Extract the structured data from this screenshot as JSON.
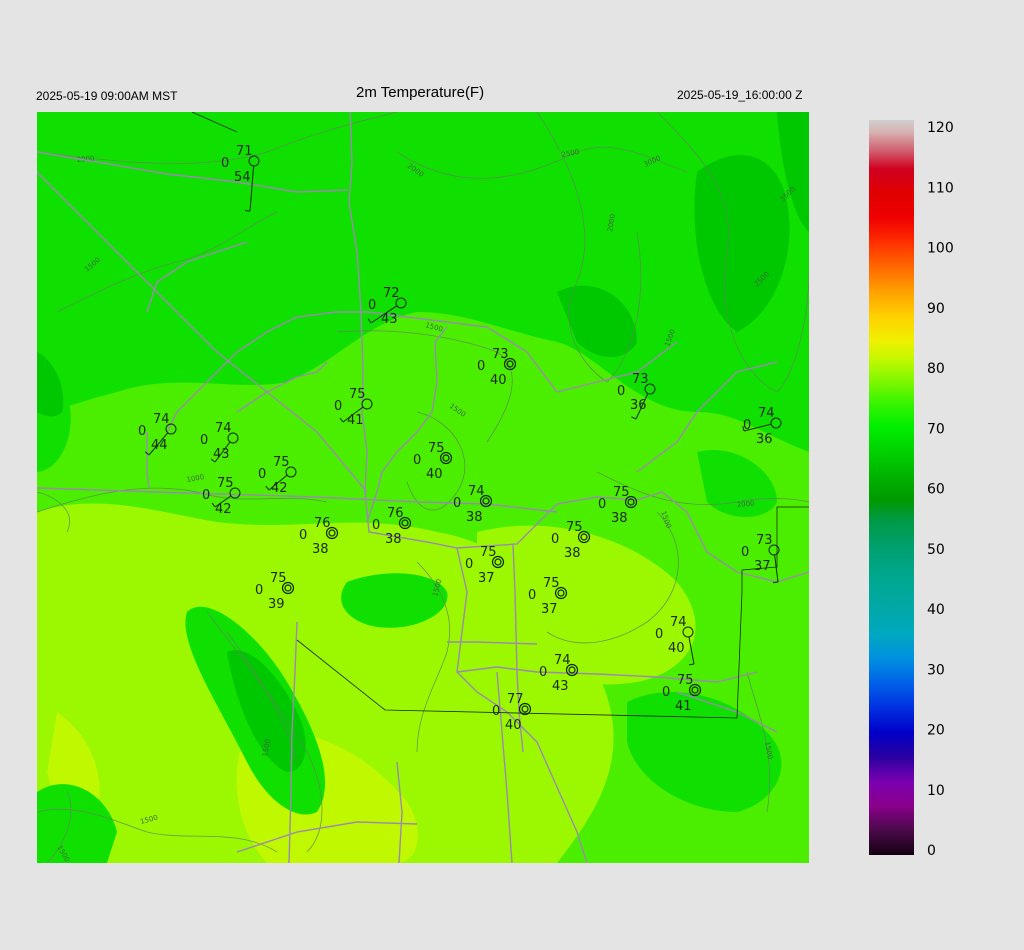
{
  "header": {
    "valid_local": "2025-05-19 09:00AM MST",
    "title": "2m Temperature(F)",
    "valid_utc": "2025-05-19_16:00:00 Z"
  },
  "colorbar": {
    "ticks": [
      "120",
      "110",
      "100",
      "90",
      "80",
      "70",
      "60",
      "50",
      "40",
      "30",
      "20",
      "10",
      "0"
    ],
    "stops": [
      {
        "v": 0,
        "c": "#150010"
      },
      {
        "v": 4,
        "c": "#4a0a4a"
      },
      {
        "v": 8,
        "c": "#8a008a"
      },
      {
        "v": 12,
        "c": "#7a00b0"
      },
      {
        "v": 16,
        "c": "#2a00a0"
      },
      {
        "v": 20,
        "c": "#0000c8"
      },
      {
        "v": 24,
        "c": "#0030e0"
      },
      {
        "v": 28,
        "c": "#0060e8"
      },
      {
        "v": 32,
        "c": "#0090e0"
      },
      {
        "v": 36,
        "c": "#00a8c0"
      },
      {
        "v": 40,
        "c": "#00a8a8"
      },
      {
        "v": 45,
        "c": "#00a890"
      },
      {
        "v": 50,
        "c": "#00a070"
      },
      {
        "v": 55,
        "c": "#009a40"
      },
      {
        "v": 58,
        "c": "#009a00"
      },
      {
        "v": 62,
        "c": "#00b400"
      },
      {
        "v": 66,
        "c": "#00d200"
      },
      {
        "v": 70,
        "c": "#00f000"
      },
      {
        "v": 74,
        "c": "#3cf400"
      },
      {
        "v": 78,
        "c": "#8cf800"
      },
      {
        "v": 81,
        "c": "#c4f800"
      },
      {
        "v": 84,
        "c": "#f0f000"
      },
      {
        "v": 88,
        "c": "#ffd000"
      },
      {
        "v": 92,
        "c": "#ffa000"
      },
      {
        "v": 96,
        "c": "#ff6800"
      },
      {
        "v": 100,
        "c": "#ff3000"
      },
      {
        "v": 104,
        "c": "#f00000"
      },
      {
        "v": 108,
        "c": "#e00000"
      },
      {
        "v": 112,
        "c": "#d00020"
      },
      {
        "v": 115,
        "c": "#d06070"
      },
      {
        "v": 118,
        "c": "#d8b0b0"
      },
      {
        "v": 120,
        "c": "#d0d0d0"
      }
    ]
  },
  "map": {
    "fill_colors": {
      "base": "#4cee00",
      "warm": "#9cf800",
      "warmer": "#c0f800",
      "cool": "#10e000",
      "cooler": "#00c800"
    },
    "contour_labels": [
      "2000",
      "2000",
      "2500",
      "3000",
      "2000",
      "2500",
      "3500",
      "1500",
      "1500",
      "1500",
      "1500",
      "1000",
      "1500",
      "2000",
      "1500",
      "1500",
      "1500",
      "1500",
      "1500"
    ],
    "stations": [
      {
        "temp": "71",
        "dew": "54",
        "cloud": "0",
        "sky": "clear",
        "wind": "staff"
      },
      {
        "temp": "72",
        "dew": "43",
        "cloud": "0",
        "sky": "clear",
        "wind": "staff"
      },
      {
        "temp": "73",
        "dew": "40",
        "cloud": "0",
        "sky": "calm",
        "wind": "calm"
      },
      {
        "temp": "73",
        "dew": "36",
        "cloud": "0",
        "sky": "clear",
        "wind": "staff"
      },
      {
        "temp": "74",
        "dew": "36",
        "cloud": "0",
        "sky": "clear",
        "wind": "staff"
      },
      {
        "temp": "75",
        "dew": "41",
        "cloud": "0",
        "sky": "clear",
        "wind": "staff"
      },
      {
        "temp": "74",
        "dew": "44",
        "cloud": "0",
        "sky": "clear",
        "wind": "staff"
      },
      {
        "temp": "74",
        "dew": "43",
        "cloud": "0",
        "sky": "clear",
        "wind": "staff"
      },
      {
        "temp": "75",
        "dew": "40",
        "cloud": "0",
        "sky": "calm",
        "wind": "calm"
      },
      {
        "temp": "75",
        "dew": "42",
        "cloud": "0",
        "sky": "clear",
        "wind": "staff"
      },
      {
        "temp": "75",
        "dew": "42",
        "cloud": "0",
        "sky": "clear",
        "wind": "staff"
      },
      {
        "temp": "74",
        "dew": "38",
        "cloud": "0",
        "sky": "calm",
        "wind": "calm"
      },
      {
        "temp": "75",
        "dew": "38",
        "cloud": "0",
        "sky": "calm",
        "wind": "calm"
      },
      {
        "temp": "76",
        "dew": "38",
        "cloud": "0",
        "sky": "calm",
        "wind": "calm"
      },
      {
        "temp": "76",
        "dew": "38",
        "cloud": "0",
        "sky": "calm",
        "wind": "calm"
      },
      {
        "temp": "75",
        "dew": "38",
        "cloud": "0",
        "sky": "calm",
        "wind": "calm"
      },
      {
        "temp": "73",
        "dew": "37",
        "cloud": "0",
        "sky": "clear",
        "wind": "staff"
      },
      {
        "temp": "75",
        "dew": "37",
        "cloud": "0",
        "sky": "calm",
        "wind": "calm"
      },
      {
        "temp": "75",
        "dew": "39",
        "cloud": "0",
        "sky": "calm",
        "wind": "calm"
      },
      {
        "temp": "75",
        "dew": "37",
        "cloud": "0",
        "sky": "calm",
        "wind": "calm"
      },
      {
        "temp": "74",
        "dew": "40",
        "cloud": "0",
        "sky": "clear",
        "wind": "staff"
      },
      {
        "temp": "74",
        "dew": "43",
        "cloud": "0",
        "sky": "calm",
        "wind": "calm"
      },
      {
        "temp": "75",
        "dew": "41",
        "cloud": "0",
        "sky": "calm",
        "wind": "calm"
      },
      {
        "temp": "77",
        "dew": "40",
        "cloud": "0",
        "sky": "calm",
        "wind": "calm"
      }
    ]
  }
}
